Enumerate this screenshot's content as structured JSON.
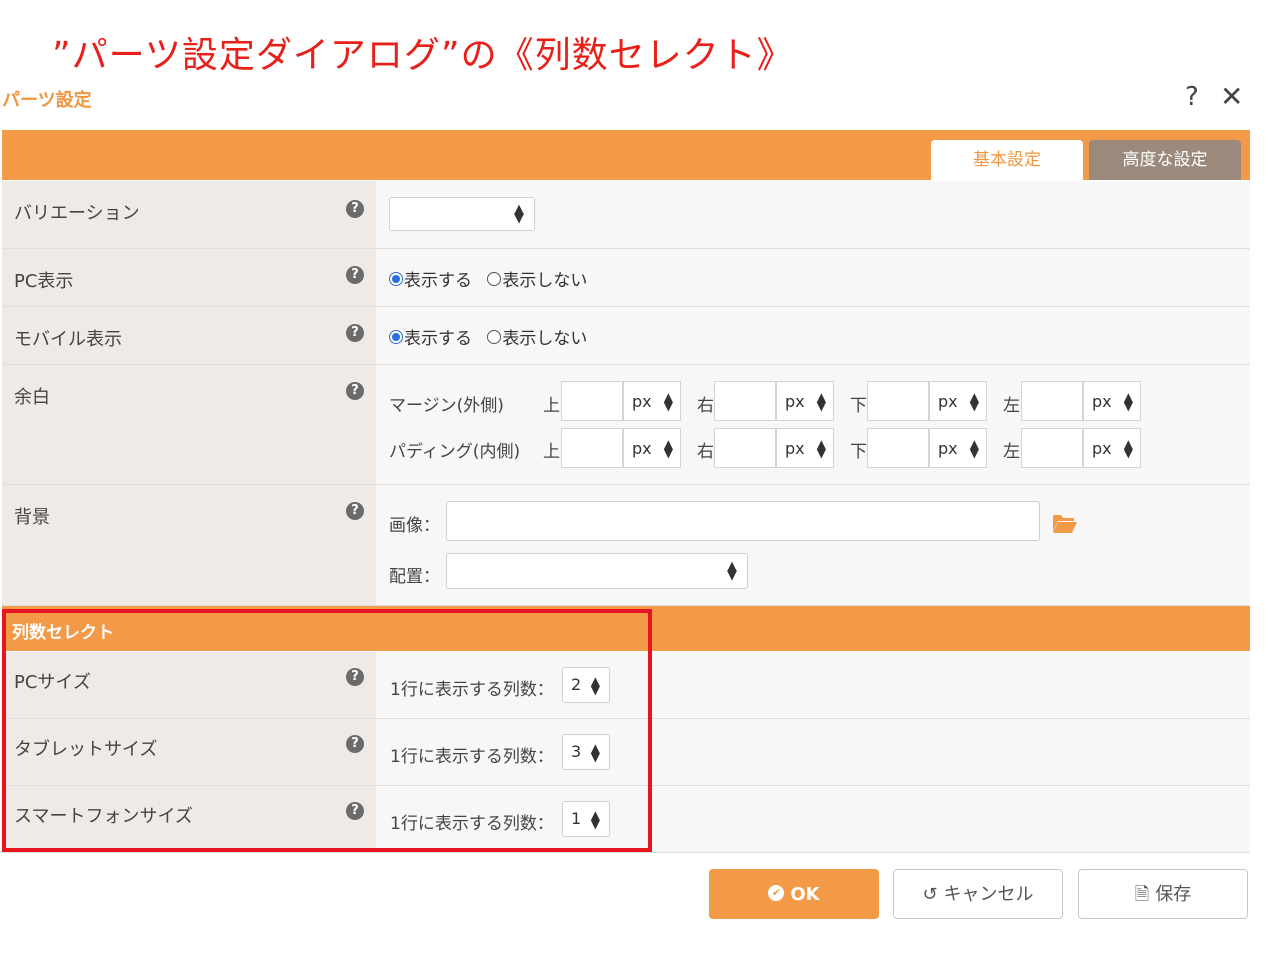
{
  "heading": "”パーツ設定ダイアログ”の《列数セレクト》",
  "dialog": {
    "title": "パーツ設定",
    "help": "?",
    "close": "✕"
  },
  "tabs": [
    {
      "label": "基本設定",
      "active": true
    },
    {
      "label": "高度な設定",
      "active": false
    }
  ],
  "rows": {
    "variation": {
      "label": "バリエーション",
      "value": ""
    },
    "pc_display": {
      "label": "PC表示",
      "options": [
        "表示する",
        "表示しない"
      ],
      "selected": "表示する"
    },
    "mobile_display": {
      "label": "モバイル表示",
      "options": [
        "表示する",
        "表示しない"
      ],
      "selected": "表示する"
    },
    "spacing": {
      "label": "余白",
      "margin_label": "マージン(外側)",
      "padding_label": "パディング(内側)",
      "sides": [
        "上",
        "右",
        "下",
        "左"
      ],
      "unit": "px"
    },
    "background": {
      "label": "背景",
      "image_label": "画像：",
      "image_value": "",
      "position_label": "配置：",
      "position_value": ""
    }
  },
  "column_select": {
    "title": "列数セレクト",
    "per_row_label": "1行に表示する列数：",
    "items": [
      {
        "label": "PCサイズ",
        "value": "2"
      },
      {
        "label": "タブレットサイズ",
        "value": "3"
      },
      {
        "label": "スマートフォンサイズ",
        "value": "1"
      }
    ]
  },
  "buttons": {
    "ok": "OK",
    "cancel": "キャンセル",
    "save": "保存"
  },
  "colors": {
    "accent": "#f39a48",
    "highlight_red": "#e6141e",
    "heading_red": "#e8201a",
    "tab_inactive": "#9b8a7c"
  }
}
